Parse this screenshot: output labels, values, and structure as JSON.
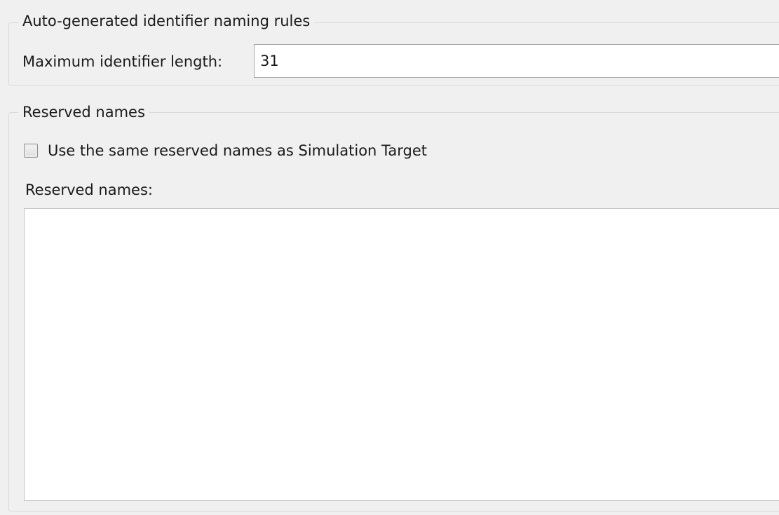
{
  "naming_rules": {
    "title": "Auto-generated identifier naming rules",
    "max_length_label": "Maximum identifier length:",
    "max_length_value": "31"
  },
  "reserved_names": {
    "title": "Reserved names",
    "use_same_checkbox": {
      "label": "Use the same reserved names as Simulation Target",
      "checked": false
    },
    "list_label": "Reserved names:",
    "list_value": ""
  }
}
